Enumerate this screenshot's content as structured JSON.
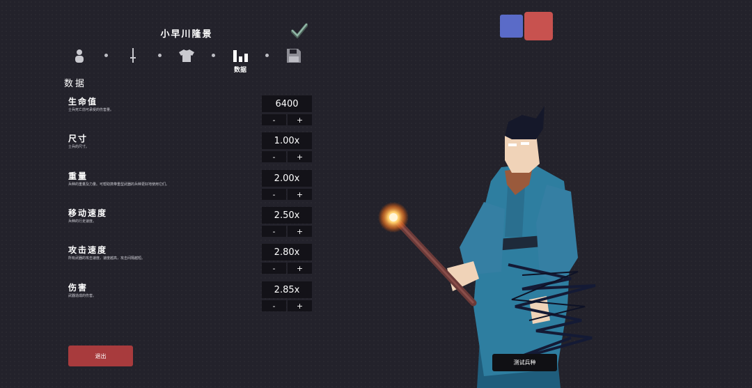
{
  "header": {
    "unit_name": "小早川隆景"
  },
  "tabs": [
    {
      "icon": "person-icon",
      "label": ""
    },
    {
      "icon": "sword-icon",
      "label": ""
    },
    {
      "icon": "shirt-icon",
      "label": ""
    },
    {
      "icon": "bar-chart-icon",
      "label": "数据"
    },
    {
      "icon": "save-icon",
      "label": ""
    }
  ],
  "section_title": "数据",
  "stats": [
    {
      "name": "生命值",
      "desc": "士兵死亡前可承受的伤害量。",
      "value": "6400",
      "minus": "-",
      "plus": "+"
    },
    {
      "name": "尺寸",
      "desc": "士兵的尺寸。",
      "value": "1.00x",
      "minus": "-",
      "plus": "+"
    },
    {
      "name": "重量",
      "desc": "兵种的重量及力量。可帮助携带重型武器的兵种更好地使用它们。",
      "value": "2.00x",
      "minus": "-",
      "plus": "+"
    },
    {
      "name": "移动速度",
      "desc": "兵种的行走速度。",
      "value": "2.50x",
      "minus": "-",
      "plus": "+"
    },
    {
      "name": "攻击速度",
      "desc": "所有武器的攻击速度。速度越高，攻击间隔越短。",
      "value": "2.80x",
      "minus": "-",
      "plus": "+"
    },
    {
      "name": "伤害",
      "desc": "武器造成的伤害。",
      "value": "2.85x",
      "minus": "-",
      "plus": "+"
    }
  ],
  "buttons": {
    "exit": "退出",
    "test_unit": "测试兵种"
  },
  "colors": {
    "team_blue": "#5a6bc8",
    "team_red": "#c8524f",
    "exit_button": "#a83b3d",
    "background": "#23222b"
  }
}
